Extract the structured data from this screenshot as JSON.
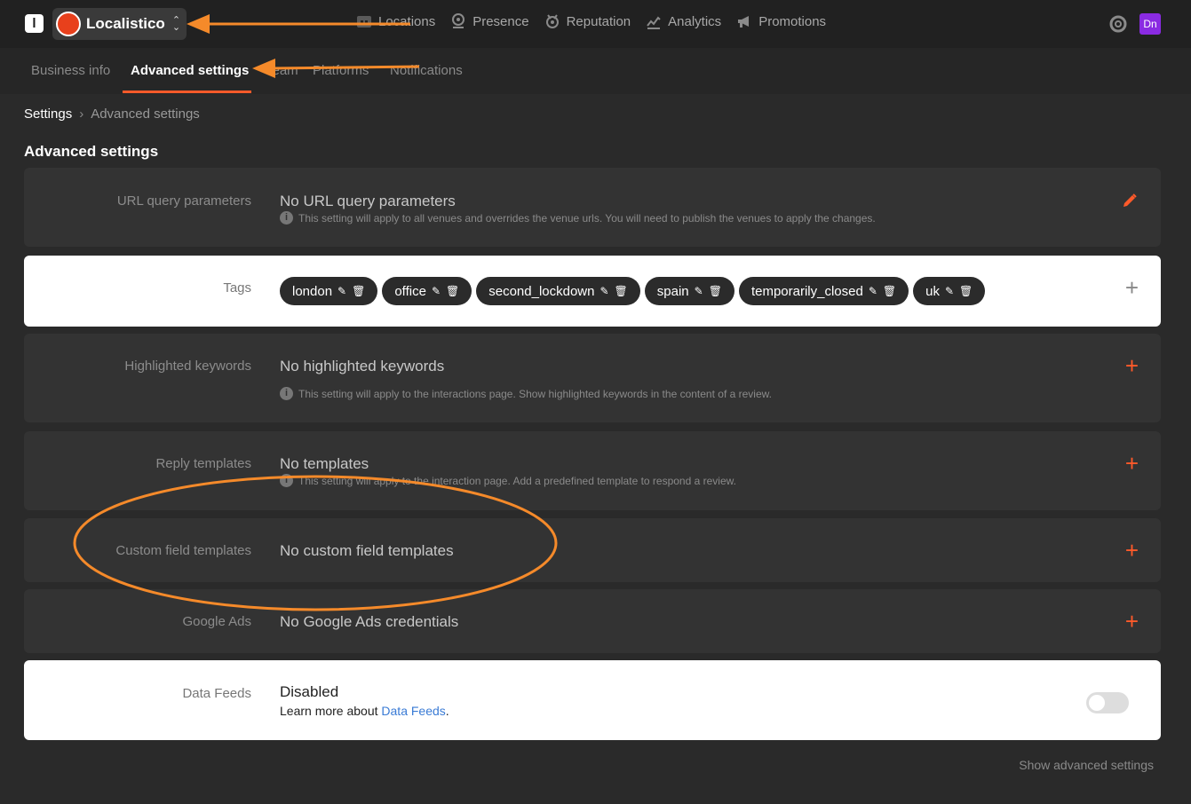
{
  "app": {
    "logo_letter": "l",
    "org_name": "Localistico"
  },
  "nav": [
    {
      "label": "Locations",
      "icon": "locations-icon"
    },
    {
      "label": "Presence",
      "icon": "presence-icon"
    },
    {
      "label": "Reputation",
      "icon": "reputation-icon"
    },
    {
      "label": "Analytics",
      "icon": "analytics-icon"
    },
    {
      "label": "Promotions",
      "icon": "megaphone-icon"
    }
  ],
  "user": {
    "initials": "Dn"
  },
  "subtabs": [
    {
      "label": "Business info"
    },
    {
      "label": "Advanced settings",
      "active": true
    },
    {
      "label": "Team"
    },
    {
      "label": "Platforms"
    },
    {
      "label": "Notifications"
    }
  ],
  "breadcrumb": {
    "root": "Settings",
    "separator": "›",
    "current": "Advanced settings"
  },
  "page_title": "Advanced settings",
  "rows": {
    "url": {
      "label": "URL query parameters",
      "value": "No URL query parameters",
      "hint": "This setting will apply to all venues and overrides the venue urls. You will need to publish the venues to apply the changes."
    },
    "tags": {
      "label": "Tags",
      "items": [
        "london",
        "office",
        "second_lockdown",
        "spain",
        "temporarily_closed",
        "uk"
      ]
    },
    "keywords": {
      "label": "Highlighted keywords",
      "value": "No highlighted keywords",
      "hint": "This setting will apply to the interactions page. Show highlighted keywords in the content of a review."
    },
    "reply": {
      "label": "Reply templates",
      "value": "No templates",
      "hint": "This setting will apply to the interaction page. Add a predefined template to respond a review."
    },
    "custom": {
      "label": "Custom field templates",
      "value": "No custom field templates"
    },
    "gads": {
      "label": "Google Ads",
      "value": "No Google Ads credentials"
    },
    "feeds": {
      "label": "Data Feeds",
      "value": "Disabled",
      "learn_prefix": "Learn more about ",
      "learn_link": "Data Feeds",
      "learn_suffix": ".",
      "enabled": false
    }
  },
  "footer": {
    "show_advanced": "Show advanced settings"
  },
  "colors": {
    "accent": "#ff5a2a",
    "annotation": "#f58a2a",
    "link": "#3a7bd5"
  }
}
